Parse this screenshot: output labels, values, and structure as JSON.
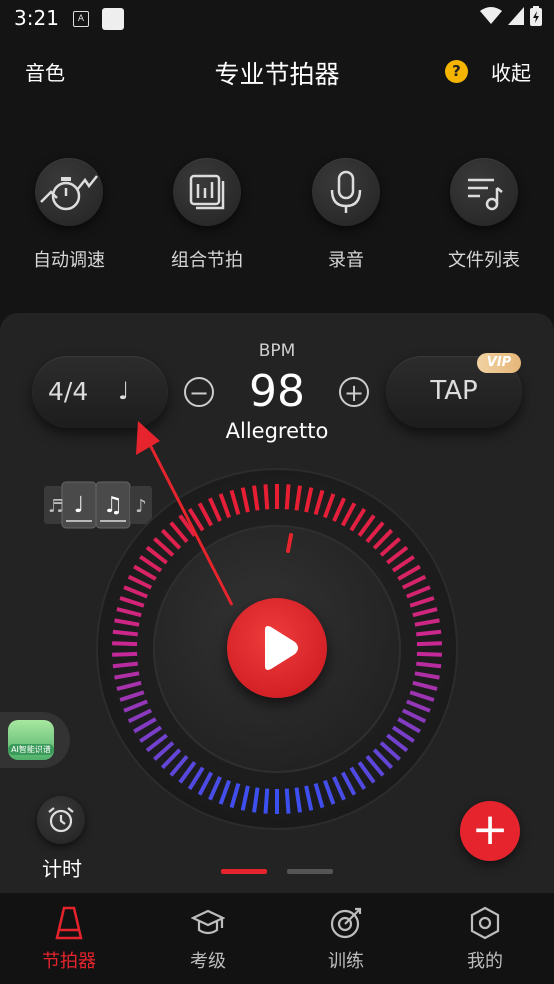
{
  "status_bar": {
    "time": "3:21",
    "a_badge": "A"
  },
  "header": {
    "left_label": "音色",
    "title": "专业节拍器",
    "help_icon": "?",
    "right_label": "收起"
  },
  "tools": [
    {
      "label": "自动调速",
      "icon": "auto-tempo-icon"
    },
    {
      "label": "组合节拍",
      "icon": "combo-beat-icon"
    },
    {
      "label": "录音",
      "icon": "microphone-icon"
    },
    {
      "label": "文件列表",
      "icon": "file-list-icon"
    }
  ],
  "metronome": {
    "time_signature": "4/4",
    "note_symbol": "♩",
    "bpm_label": "BPM",
    "bpm": "98",
    "tempo_name": "Allegretto",
    "minus": "−",
    "plus": "+",
    "tap_label": "TAP",
    "vip_badge": "VIP"
  },
  "ai_badge": "AI智能识谱",
  "timer": {
    "label": "计时"
  },
  "fab": {
    "symbol": "+"
  },
  "bottom_nav": [
    {
      "label": "节拍器",
      "icon": "metronome-icon",
      "active": true
    },
    {
      "label": "考级",
      "icon": "graduation-cap-icon",
      "active": false
    },
    {
      "label": "训练",
      "icon": "target-icon",
      "active": false
    },
    {
      "label": "我的",
      "icon": "profile-hexagon-icon",
      "active": false
    }
  ],
  "colors": {
    "accent": "#e5242d",
    "background": "#141414",
    "panel": "#232323",
    "help": "#f4b400"
  }
}
